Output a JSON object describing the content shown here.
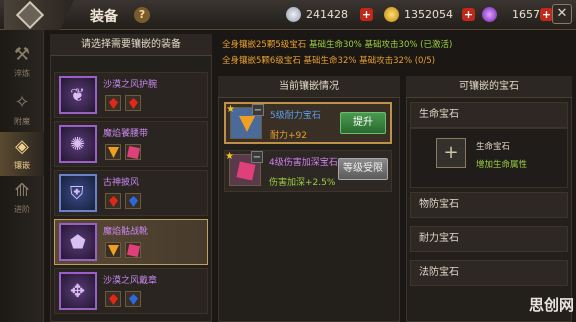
{
  "header": {
    "title": "装备",
    "help_label": "?",
    "close_label": "✕",
    "currencies": [
      {
        "icon": "silver-coin-icon",
        "value": "241428"
      },
      {
        "icon": "gold-coin-icon",
        "value": "1352054"
      },
      {
        "icon": "purple-gem-icon",
        "value": "1657"
      }
    ],
    "plus_label": "+"
  },
  "leftnav": {
    "items": [
      {
        "label": "淬炼",
        "icon": "refine-icon"
      },
      {
        "label": "附魔",
        "icon": "enchant-icon"
      },
      {
        "label": "镶嵌",
        "icon": "inlay-icon",
        "active": true
      },
      {
        "label": "进阶",
        "icon": "advance-icon"
      }
    ]
  },
  "equipment_list": {
    "header": "请选择需要镶嵌的装备",
    "items": [
      {
        "name": "沙漠之风护腕",
        "icon": "bracer-icon",
        "gems": [
          "red",
          "red"
        ]
      },
      {
        "name": "魔焰饕腰带",
        "icon": "belt-icon",
        "gems": [
          "orange",
          "pink"
        ]
      },
      {
        "name": "古神披风",
        "icon": "cloak-icon",
        "gems": [
          "red",
          "blue"
        ]
      },
      {
        "name": "魔焰骷战靴",
        "icon": "boots-icon",
        "gems": [
          "orange",
          "pink"
        ],
        "selected": true
      },
      {
        "name": "沙漠之风戴章",
        "icon": "badge-icon",
        "gems": [
          "red",
          "blue"
        ]
      }
    ]
  },
  "set_bonus": {
    "line1": "全身镶嵌25颗5级宝石",
    "line1_effect": "基础生命30% 基础攻击30% (已激活)",
    "line2": "全身镶嵌5颗6级宝石",
    "line2_effect": "基础生命32% 基础攻击32% (0/5)"
  },
  "current_inlay": {
    "header": "当前镶嵌情况",
    "slots": [
      {
        "name": "5级耐力宝石",
        "stat": "耐力+92",
        "button": "提升"
      },
      {
        "name": "4级伤害加深宝石",
        "stat": "伤害加深+2.5%",
        "button": "等级受限"
      }
    ],
    "minus_label": "−",
    "star_label": "★"
  },
  "available_gems": {
    "header": "可镶嵌的宝石",
    "categories": [
      "生命宝石",
      "物防宝石",
      "耐力宝石",
      "法防宝石"
    ],
    "card": {
      "add_label": "+",
      "name": "生命宝石",
      "desc": "增加生命属性"
    }
  },
  "watermark": "思创网"
}
